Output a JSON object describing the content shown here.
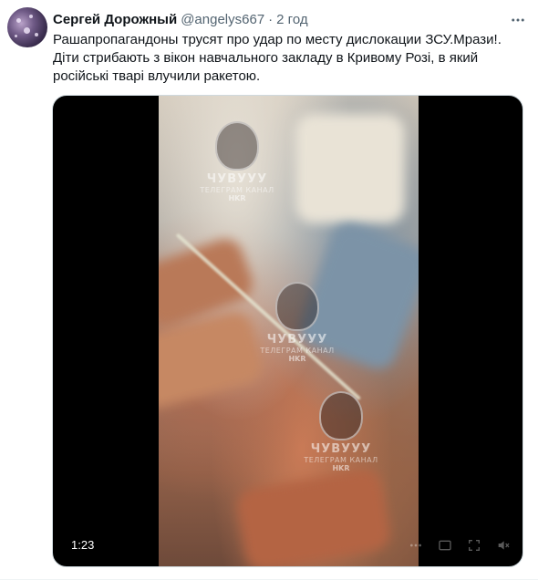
{
  "tweet": {
    "author_name": "Сергей Дорожный",
    "author_handle": "@angelys667",
    "separator": "·",
    "time": "2 год",
    "text_lines": [
      "Рашапропагандоны трусят про удар по месту дислокации ЗСУ.Мрази!.",
      "Діти стрибають з вікон навчального закладу в Кривому Розі, в який",
      "російські тварі влучили ракетою."
    ]
  },
  "media": {
    "duration": "1:23",
    "watermark": {
      "logo": "ЧУВУУУ",
      "line1": "ТЕЛЕГРАМ КАНАЛ",
      "line2": "HKR"
    },
    "icons": [
      "more-dots-icon",
      "gif-icon",
      "fullscreen-icon",
      "volume-icon"
    ]
  },
  "colors": {
    "name": "#0f1419",
    "secondary": "#536471",
    "border": "#cfd9de",
    "media_bg": "#000000"
  }
}
